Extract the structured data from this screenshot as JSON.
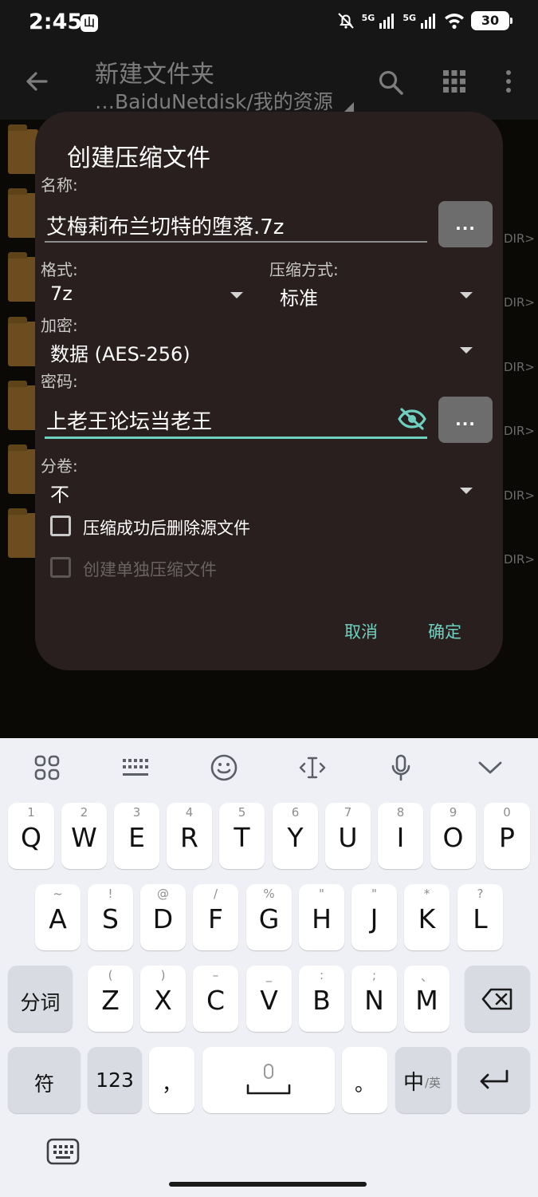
{
  "status_bar": {
    "time": "2:45",
    "app_badge": "山",
    "signal_label_1": "5G",
    "signal_label_2": "5G",
    "battery": "30"
  },
  "toolbar": {
    "title": "新建文件夹",
    "path": "…BaiduNetdisk/我的资源"
  },
  "file_list": {
    "dir_tags": [
      "DIR>",
      "DIR>",
      "DIR>",
      "DIR>",
      "DIR>",
      "DIR>"
    ]
  },
  "dialog": {
    "title": "创建压缩文件",
    "name_label": "名称:",
    "name_value": "艾梅莉布兰切特的堕落.7z",
    "browse_label": "...",
    "format_label": "格式:",
    "format_value": "7z",
    "method_label": "压缩方式:",
    "method_value": "标准",
    "encryption_label": "加密:",
    "encryption_value": "数据 (AES-256)",
    "password_label": "密码:",
    "password_value": "上老王论坛当老王",
    "password_more_label": "...",
    "split_label": "分卷:",
    "split_value": "不",
    "delete_source_label": "压缩成功后删除源文件",
    "separate_archives_label": "创建单独压缩文件",
    "cancel_label": "取消",
    "ok_label": "确定"
  },
  "colors": {
    "accent": "#6ed1c0",
    "dialog_bg": "#291f1e",
    "keyboard_bg": "#eef0f5"
  },
  "keyboard": {
    "toolbar_icons": [
      "apps-grid-icon",
      "keyboard-layout-icon",
      "emoji-icon",
      "text-cursor-icon",
      "microphone-icon",
      "collapse-chevron-icon"
    ],
    "row1": [
      {
        "key": "Q",
        "hint": "1"
      },
      {
        "key": "W",
        "hint": "2"
      },
      {
        "key": "E",
        "hint": "3"
      },
      {
        "key": "R",
        "hint": "4"
      },
      {
        "key": "T",
        "hint": "5"
      },
      {
        "key": "Y",
        "hint": "6"
      },
      {
        "key": "U",
        "hint": "7"
      },
      {
        "key": "I",
        "hint": "8"
      },
      {
        "key": "O",
        "hint": "9"
      },
      {
        "key": "P",
        "hint": "0"
      }
    ],
    "row2": [
      {
        "key": "A",
        "hint": "~"
      },
      {
        "key": "S",
        "hint": "!"
      },
      {
        "key": "D",
        "hint": "@"
      },
      {
        "key": "F",
        "hint": "/"
      },
      {
        "key": "G",
        "hint": "%"
      },
      {
        "key": "H",
        "hint": "\""
      },
      {
        "key": "J",
        "hint": "\""
      },
      {
        "key": "K",
        "hint": "*"
      },
      {
        "key": "L",
        "hint": "?"
      }
    ],
    "row3": [
      {
        "key": "Z",
        "hint": "("
      },
      {
        "key": "X",
        "hint": ")"
      },
      {
        "key": "C",
        "hint": "–"
      },
      {
        "key": "V",
        "hint": "_"
      },
      {
        "key": "B",
        "hint": ":"
      },
      {
        "key": "N",
        "hint": ";"
      },
      {
        "key": "M",
        "hint": "、"
      }
    ],
    "segment_label": "分词",
    "symbols_label": "符",
    "numbers_label": "123",
    "comma_label": "，",
    "period_label": "。",
    "lang_main": "中",
    "lang_sub": "/英"
  }
}
